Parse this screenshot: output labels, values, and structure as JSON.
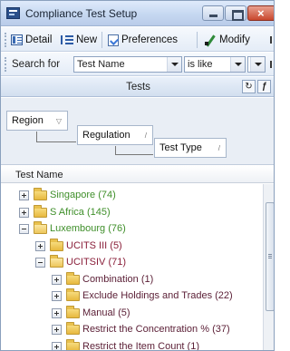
{
  "window": {
    "title": "Compliance Test Setup"
  },
  "toolbar": {
    "detail_label": "Detail",
    "new_label": "New",
    "preferences_label": "Preferences",
    "modify_label": "Modify"
  },
  "search": {
    "label": "Search for",
    "field_value": "Test Name",
    "operator_value": "is like",
    "text_value": ""
  },
  "panel": {
    "title": "Tests",
    "group_by": [
      {
        "label": "Region"
      },
      {
        "label": "Regulation"
      },
      {
        "label": "Test Type"
      }
    ],
    "column_header": "Test Name"
  },
  "tree": [
    {
      "label": "Singapore (74)",
      "expanded": false,
      "level": 0,
      "color": "#3f8f2a"
    },
    {
      "label": "S Africa (145)",
      "expanded": false,
      "level": 0,
      "color": "#3f8f2a"
    },
    {
      "label": "Luxembourg (76)",
      "expanded": true,
      "level": 0,
      "color": "#3f8f2a"
    },
    {
      "label": "UCITS III (5)",
      "expanded": false,
      "level": 1,
      "color": "#8a1f3a"
    },
    {
      "label": "UCITSIV (71)",
      "expanded": true,
      "level": 1,
      "color": "#8a1f3a"
    },
    {
      "label": "Combination (1)",
      "expanded": false,
      "level": 2,
      "color": "#5a1e35"
    },
    {
      "label": "Exclude Holdings and Trades (22)",
      "expanded": false,
      "level": 2,
      "color": "#5a1e35"
    },
    {
      "label": "Manual (5)",
      "expanded": false,
      "level": 2,
      "color": "#5a1e35"
    },
    {
      "label": "Restrict the Concentration % (37)",
      "expanded": false,
      "level": 2,
      "color": "#5a1e35"
    },
    {
      "label": "Restrict the Item Count (1)",
      "expanded": false,
      "level": 2,
      "color": "#5a1e35"
    }
  ]
}
